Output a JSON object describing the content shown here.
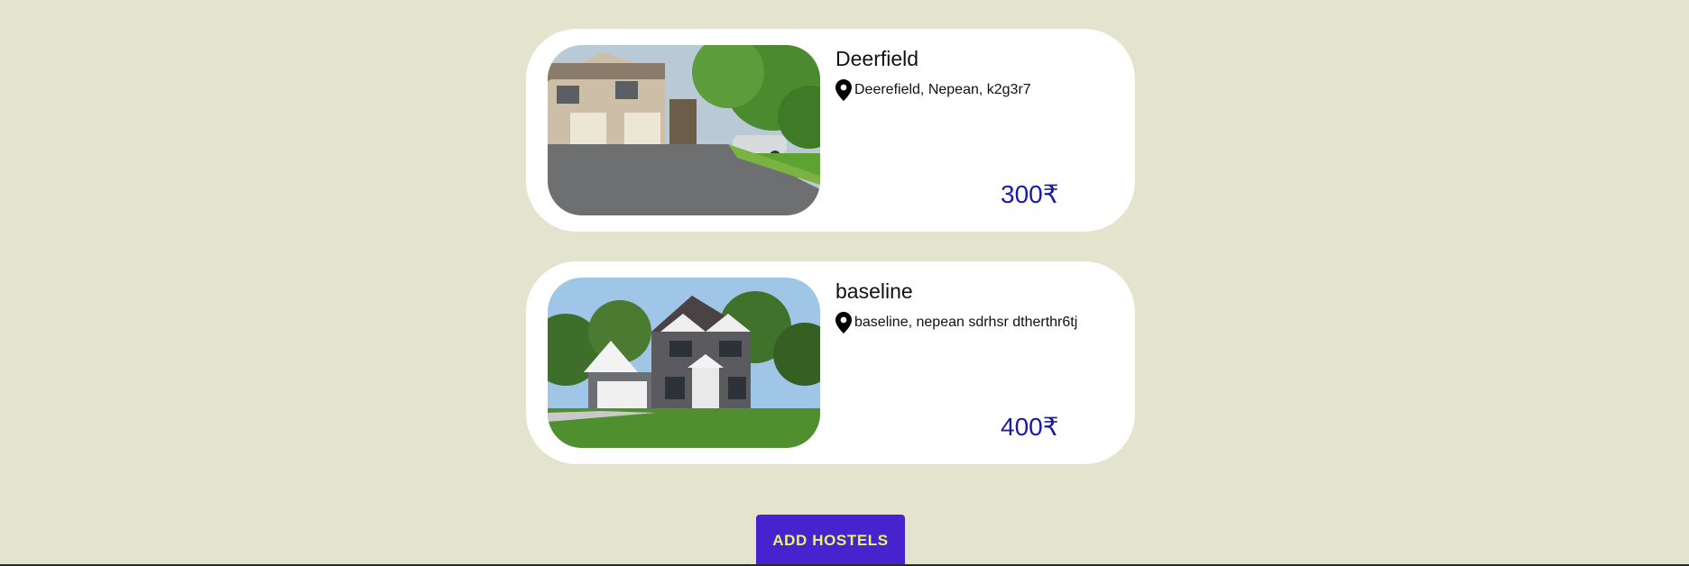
{
  "listings": [
    {
      "image_alt": "townhouse-photo",
      "title": "Deerfield",
      "address_icon": "location-pin-icon",
      "address": "Deerefield, Nepean, k2g3r7",
      "price": "300₹"
    },
    {
      "image_alt": "house-photo",
      "title": "baseline",
      "address_icon": "location-pin-icon",
      "address": "baseline, nepean sdrhsr dtherthr6tj",
      "price": "400₹"
    }
  ],
  "add_button_label": "ADD HOSTELS",
  "colors": {
    "background": "#e4e3cd",
    "card": "#ffffff",
    "price": "#1a1aa8",
    "button_bg": "#4722cf",
    "button_text": "#e8f56a"
  }
}
